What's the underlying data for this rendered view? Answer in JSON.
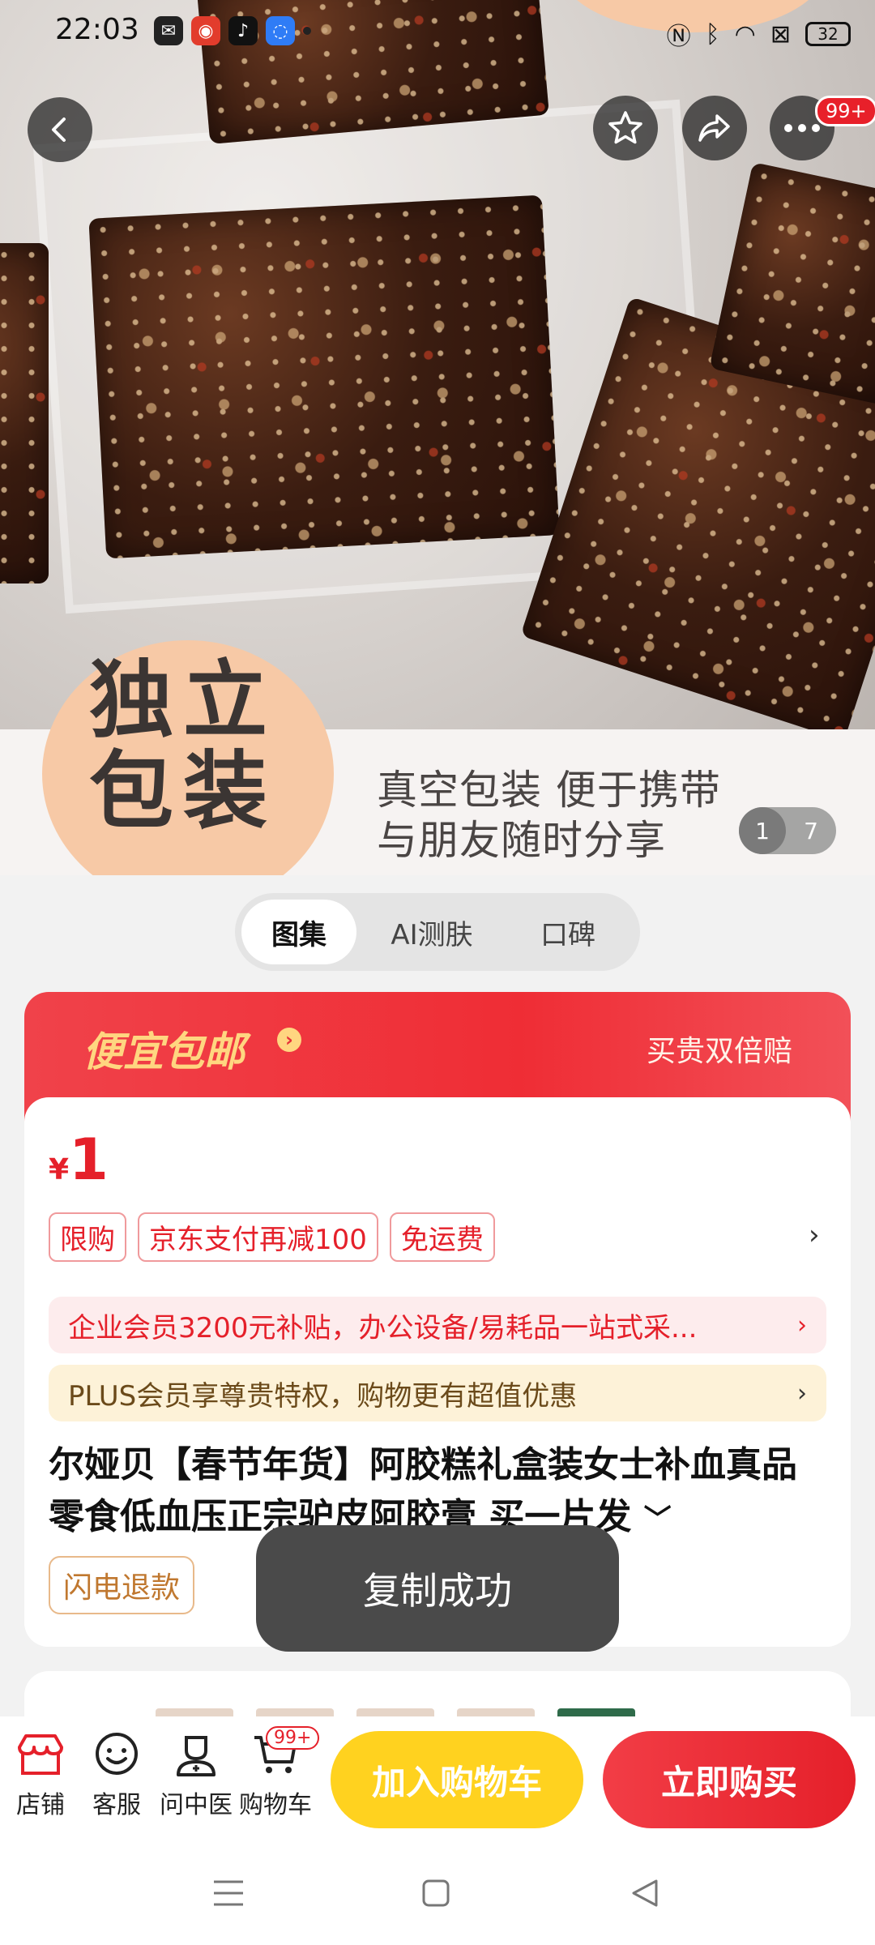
{
  "status_bar": {
    "time": "22:03",
    "apps": [
      "wechat-icon",
      "weibo-icon",
      "tiktok-icon",
      "browser-icon"
    ],
    "battery": "32"
  },
  "hero": {
    "badge_text": "独立包装",
    "caption_line1": "真空包装 便于携带",
    "caption_line2": "与朋友随时分享",
    "page_current": "1",
    "page_total": "7"
  },
  "top_actions": {
    "more_badge": "99+"
  },
  "tabs": [
    {
      "label": "图集",
      "active": true
    },
    {
      "label": "AI测肤",
      "active": false
    },
    {
      "label": "口碑",
      "active": false
    }
  ],
  "promo_banner": {
    "title": "便宜包邮",
    "guarantee": "买贵双倍赔"
  },
  "product": {
    "currency": "¥",
    "price": "1",
    "tags": [
      "限购",
      "京东支付再减100",
      "免运费"
    ],
    "enterprise_strip": "企业会员3200元补贴，办公设备/易耗品一站式采...",
    "plus_strip": "PLUS会员享尊贵特权，购物更有超值优惠",
    "title": "尔娅贝【春节年货】阿胶糕礼盒装女士补血真品零食低血压正宗驴皮阿胶膏 买一片发",
    "flash_refund": "闪电退款"
  },
  "toast": "复制成功",
  "bottom_nav": {
    "items": [
      {
        "label": "店铺",
        "icon": "store-icon"
      },
      {
        "label": "客服",
        "icon": "service-icon"
      },
      {
        "label": "问中医",
        "icon": "doctor-icon"
      },
      {
        "label": "购物车",
        "icon": "cart-icon"
      }
    ],
    "cart_badge": "99+",
    "add_to_cart": "加入购物车",
    "buy_now": "立即购买"
  },
  "colors": {
    "brand_red": "#e5202a",
    "cart_yellow": "#ffd21f",
    "promo_gold": "#ffd680"
  }
}
